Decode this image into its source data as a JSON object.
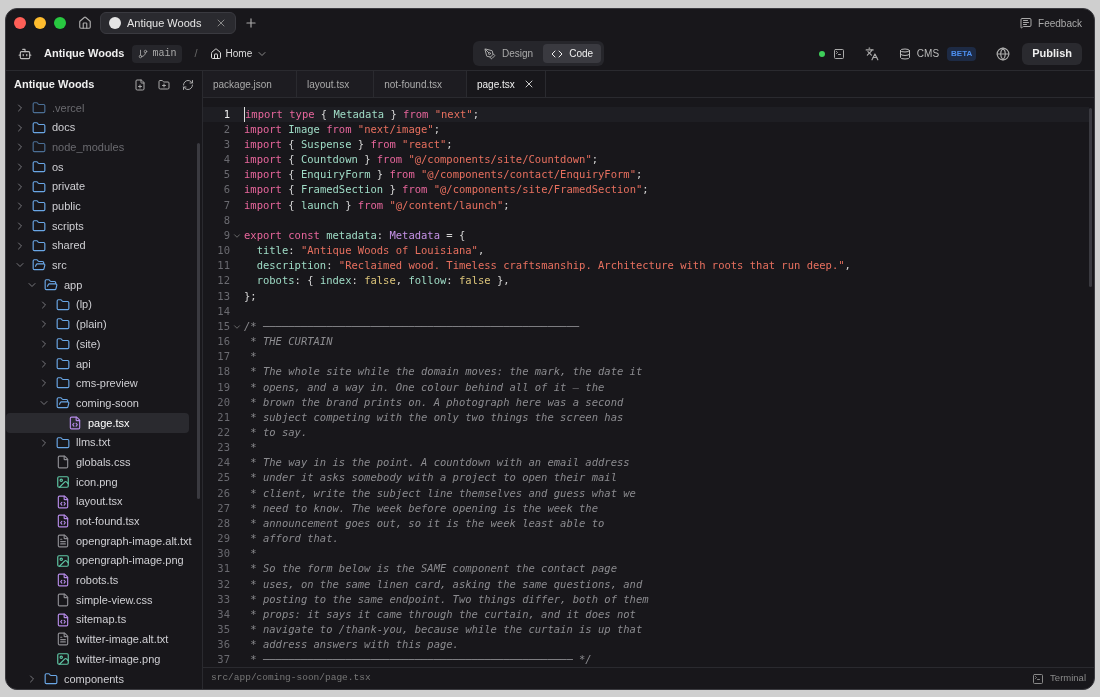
{
  "browser_tabs": [
    {
      "label": "Antique Woods",
      "selected": true
    }
  ],
  "feedback": "Feedback",
  "toolbar": {
    "project": "Antique Woods",
    "branch": "main",
    "separator": "/",
    "page": "Home",
    "modes": [
      {
        "label": "Design",
        "kind": "design",
        "selected": false
      },
      {
        "label": "Code",
        "kind": "code",
        "selected": true
      }
    ],
    "cms": "CMS",
    "cms_badge": "BETA",
    "publish": "Publish"
  },
  "sidebar": {
    "title": "Antique Woods",
    "tree": [
      {
        "name": ".vercel",
        "kind": "folder",
        "expanded": false,
        "dimmed": true
      },
      {
        "name": "docs",
        "kind": "folder",
        "expanded": false,
        "dimmed": false
      },
      {
        "name": "node_modules",
        "kind": "folder",
        "expanded": false,
        "dimmed": true
      },
      {
        "name": "os",
        "kind": "folder",
        "expanded": false,
        "dimmed": false
      },
      {
        "name": "private",
        "kind": "folder",
        "expanded": false,
        "dimmed": false
      },
      {
        "name": "public",
        "kind": "folder",
        "expanded": false,
        "dimmed": false
      },
      {
        "name": "scripts",
        "kind": "folder",
        "expanded": false,
        "dimmed": false
      },
      {
        "name": "shared",
        "kind": "folder",
        "expanded": false,
        "dimmed": false
      },
      {
        "name": "src",
        "kind": "folder",
        "expanded": true,
        "dimmed": false,
        "children": [
          {
            "name": "app",
            "kind": "folder",
            "expanded": true,
            "dimmed": false,
            "children": [
              {
                "name": "(lp)",
                "kind": "folder",
                "expanded": false,
                "dimmed": false
              },
              {
                "name": "(plain)",
                "kind": "folder",
                "expanded": false,
                "dimmed": false
              },
              {
                "name": "(site)",
                "kind": "folder",
                "expanded": false,
                "dimmed": false
              },
              {
                "name": "api",
                "kind": "folder",
                "expanded": false,
                "dimmed": false
              },
              {
                "name": "cms-preview",
                "kind": "folder",
                "expanded": false,
                "dimmed": false
              },
              {
                "name": "coming-soon",
                "kind": "folder",
                "expanded": true,
                "dimmed": false,
                "children": [
                  {
                    "name": "page.tsx",
                    "kind": "code",
                    "selected": true
                  }
                ]
              },
              {
                "name": "llms.txt",
                "kind": "folder",
                "expanded": false,
                "dimmed": false
              },
              {
                "name": "globals.css",
                "kind": "file",
                "selected": false
              },
              {
                "name": "icon.png",
                "kind": "image",
                "selected": false
              },
              {
                "name": "layout.tsx",
                "kind": "code",
                "selected": false
              },
              {
                "name": "not-found.tsx",
                "kind": "code",
                "selected": false
              },
              {
                "name": "opengraph-image.alt.txt",
                "kind": "text",
                "selected": false
              },
              {
                "name": "opengraph-image.png",
                "kind": "image",
                "selected": false
              },
              {
                "name": "robots.ts",
                "kind": "code",
                "selected": false
              },
              {
                "name": "simple-view.css",
                "kind": "file",
                "selected": false
              },
              {
                "name": "sitemap.ts",
                "kind": "code",
                "selected": false
              },
              {
                "name": "twitter-image.alt.txt",
                "kind": "text",
                "selected": false
              },
              {
                "name": "twitter-image.png",
                "kind": "image",
                "selected": false
              }
            ]
          },
          {
            "name": "components",
            "kind": "folder",
            "expanded": false,
            "dimmed": false
          }
        ]
      }
    ]
  },
  "editor_tabs": [
    {
      "label": "package.json",
      "selected": false
    },
    {
      "label": "layout.tsx",
      "selected": false
    },
    {
      "label": "not-found.tsx",
      "selected": false
    },
    {
      "label": "page.tsx",
      "selected": true
    }
  ],
  "code": [
    {
      "n": "1",
      "active": true,
      "fold": false,
      "tokens": [
        {
          "text": "import type ",
          "kind": "keyword"
        },
        {
          "text": "{ ",
          "kind": "punctuation"
        },
        {
          "text": "Metadata ",
          "kind": "identifier"
        },
        {
          "text": "} ",
          "kind": "punctuation"
        },
        {
          "text": "from ",
          "kind": "keyword"
        },
        {
          "text": "\"next\"",
          "kind": "string"
        },
        {
          "text": ";",
          "kind": "punctuation"
        }
      ]
    },
    {
      "n": "2",
      "active": false,
      "fold": false,
      "tokens": [
        {
          "text": "import ",
          "kind": "keyword"
        },
        {
          "text": "Image ",
          "kind": "identifier"
        },
        {
          "text": "from ",
          "kind": "keyword"
        },
        {
          "text": "\"next/image\"",
          "kind": "string"
        },
        {
          "text": ";",
          "kind": "punctuation"
        }
      ]
    },
    {
      "n": "3",
      "active": false,
      "fold": false,
      "tokens": [
        {
          "text": "import ",
          "kind": "keyword"
        },
        {
          "text": "{ ",
          "kind": "punctuation"
        },
        {
          "text": "Suspense ",
          "kind": "identifier"
        },
        {
          "text": "} ",
          "kind": "punctuation"
        },
        {
          "text": "from ",
          "kind": "keyword"
        },
        {
          "text": "\"react\"",
          "kind": "string"
        },
        {
          "text": ";",
          "kind": "punctuation"
        }
      ]
    },
    {
      "n": "4",
      "active": false,
      "fold": false,
      "tokens": [
        {
          "text": "import ",
          "kind": "keyword"
        },
        {
          "text": "{ ",
          "kind": "punctuation"
        },
        {
          "text": "Countdown ",
          "kind": "identifier"
        },
        {
          "text": "} ",
          "kind": "punctuation"
        },
        {
          "text": "from ",
          "kind": "keyword"
        },
        {
          "text": "\"@/components/site/Countdown\"",
          "kind": "string"
        },
        {
          "text": ";",
          "kind": "punctuation"
        }
      ]
    },
    {
      "n": "5",
      "active": false,
      "fold": false,
      "tokens": [
        {
          "text": "import ",
          "kind": "keyword"
        },
        {
          "text": "{ ",
          "kind": "punctuation"
        },
        {
          "text": "EnquiryForm ",
          "kind": "identifier"
        },
        {
          "text": "} ",
          "kind": "punctuation"
        },
        {
          "text": "from ",
          "kind": "keyword"
        },
        {
          "text": "\"@/components/contact/EnquiryForm\"",
          "kind": "string"
        },
        {
          "text": ";",
          "kind": "punctuation"
        }
      ]
    },
    {
      "n": "6",
      "active": false,
      "fold": false,
      "tokens": [
        {
          "text": "import ",
          "kind": "keyword"
        },
        {
          "text": "{ ",
          "kind": "punctuation"
        },
        {
          "text": "FramedSection ",
          "kind": "identifier"
        },
        {
          "text": "} ",
          "kind": "punctuation"
        },
        {
          "text": "from ",
          "kind": "keyword"
        },
        {
          "text": "\"@/components/site/FramedSection\"",
          "kind": "string"
        },
        {
          "text": ";",
          "kind": "punctuation"
        }
      ]
    },
    {
      "n": "7",
      "active": false,
      "fold": false,
      "tokens": [
        {
          "text": "import ",
          "kind": "keyword"
        },
        {
          "text": "{ ",
          "kind": "punctuation"
        },
        {
          "text": "launch ",
          "kind": "identifier"
        },
        {
          "text": "} ",
          "kind": "punctuation"
        },
        {
          "text": "from ",
          "kind": "keyword"
        },
        {
          "text": "\"@/content/launch\"",
          "kind": "string"
        },
        {
          "text": ";",
          "kind": "punctuation"
        }
      ]
    },
    {
      "n": "8",
      "active": false,
      "fold": false
    },
    {
      "n": "9",
      "active": false,
      "fold": true,
      "tokens": [
        {
          "text": "export const ",
          "kind": "keyword"
        },
        {
          "text": "metadata",
          "kind": "identifier"
        },
        {
          "text": ": ",
          "kind": "punctuation"
        },
        {
          "text": "Metadata ",
          "kind": "type"
        },
        {
          "text": "= {",
          "kind": "punctuation"
        }
      ]
    },
    {
      "n": "10",
      "active": false,
      "fold": false,
      "tokens": [
        {
          "text": "  title",
          "kind": "identifier"
        },
        {
          "text": ": ",
          "kind": "punctuation"
        },
        {
          "text": "\"Antique Woods of Louisiana\"",
          "kind": "string"
        },
        {
          "text": ",",
          "kind": "punctuation"
        }
      ]
    },
    {
      "n": "11",
      "active": false,
      "fold": false,
      "tokens": [
        {
          "text": "  description",
          "kind": "identifier"
        },
        {
          "text": ": ",
          "kind": "punctuation"
        },
        {
          "text": "\"Reclaimed wood. Timeless craftsmanship. Architecture with roots that run deep.\"",
          "kind": "string"
        },
        {
          "text": ",",
          "kind": "punctuation"
        }
      ]
    },
    {
      "n": "12",
      "active": false,
      "fold": false,
      "tokens": [
        {
          "text": "  robots",
          "kind": "identifier"
        },
        {
          "text": ": { ",
          "kind": "punctuation"
        },
        {
          "text": "index",
          "kind": "identifier"
        },
        {
          "text": ": ",
          "kind": "punctuation"
        },
        {
          "text": "false",
          "kind": "boolean"
        },
        {
          "text": ", ",
          "kind": "punctuation"
        },
        {
          "text": "follow",
          "kind": "identifier"
        },
        {
          "text": ": ",
          "kind": "punctuation"
        },
        {
          "text": "false ",
          "kind": "boolean"
        },
        {
          "text": "},",
          "kind": "punctuation"
        }
      ]
    },
    {
      "n": "13",
      "active": false,
      "fold": false,
      "tokens": [
        {
          "text": "};",
          "kind": "punctuation"
        }
      ]
    },
    {
      "n": "14",
      "active": false,
      "fold": false
    },
    {
      "n": "15",
      "active": false,
      "fold": true,
      "tokens": [
        {
          "text": "/* ──────────────────────────────────────────────────",
          "kind": "comment"
        }
      ]
    },
    {
      "n": "16",
      "active": false,
      "fold": false,
      "tokens": [
        {
          "text": " * THE CURTAIN",
          "kind": "comment"
        }
      ]
    },
    {
      "n": "17",
      "active": false,
      "fold": false,
      "tokens": [
        {
          "text": " *",
          "kind": "comment"
        }
      ]
    },
    {
      "n": "18",
      "active": false,
      "fold": false,
      "tokens": [
        {
          "text": " * The whole site while the domain moves: the mark, the date it",
          "kind": "comment"
        }
      ]
    },
    {
      "n": "19",
      "active": false,
      "fold": false,
      "tokens": [
        {
          "text": " * opens, and a way in. One colour behind all of it — the",
          "kind": "comment"
        }
      ]
    },
    {
      "n": "20",
      "active": false,
      "fold": false,
      "tokens": [
        {
          "text": " * brown the brand prints on. A photograph here was a second",
          "kind": "comment"
        }
      ]
    },
    {
      "n": "21",
      "active": false,
      "fold": false,
      "tokens": [
        {
          "text": " * subject competing with the only two things the screen has",
          "kind": "comment"
        }
      ]
    },
    {
      "n": "22",
      "active": false,
      "fold": false,
      "tokens": [
        {
          "text": " * to say.",
          "kind": "comment"
        }
      ]
    },
    {
      "n": "23",
      "active": false,
      "fold": false,
      "tokens": [
        {
          "text": " *",
          "kind": "comment"
        }
      ]
    },
    {
      "n": "24",
      "active": false,
      "fold": false,
      "tokens": [
        {
          "text": " * The way in is the point. A countdown with an email address",
          "kind": "comment"
        }
      ]
    },
    {
      "n": "25",
      "active": false,
      "fold": false,
      "tokens": [
        {
          "text": " * under it asks somebody with a project to open their mail",
          "kind": "comment"
        }
      ]
    },
    {
      "n": "26",
      "active": false,
      "fold": false,
      "tokens": [
        {
          "text": " * client, write the subject line themselves and guess what we",
          "kind": "comment"
        }
      ]
    },
    {
      "n": "27",
      "active": false,
      "fold": false,
      "tokens": [
        {
          "text": " * need to know. The week before opening is the week the",
          "kind": "comment"
        }
      ]
    },
    {
      "n": "28",
      "active": false,
      "fold": false,
      "tokens": [
        {
          "text": " * announcement goes out, so it is the week least able to",
          "kind": "comment"
        }
      ]
    },
    {
      "n": "29",
      "active": false,
      "fold": false,
      "tokens": [
        {
          "text": " * afford that.",
          "kind": "comment"
        }
      ]
    },
    {
      "n": "30",
      "active": false,
      "fold": false,
      "tokens": [
        {
          "text": " *",
          "kind": "comment"
        }
      ]
    },
    {
      "n": "31",
      "active": false,
      "fold": false,
      "tokens": [
        {
          "text": " * So the form below is the SAME component the contact page",
          "kind": "comment"
        }
      ]
    },
    {
      "n": "32",
      "active": false,
      "fold": false,
      "tokens": [
        {
          "text": " * uses, on the same linen card, asking the same questions, and",
          "kind": "comment"
        }
      ]
    },
    {
      "n": "33",
      "active": false,
      "fold": false,
      "tokens": [
        {
          "text": " * posting to the same endpoint. Two things differ, both of them",
          "kind": "comment"
        }
      ]
    },
    {
      "n": "34",
      "active": false,
      "fold": false,
      "tokens": [
        {
          "text": " * props: it says it came through the curtain, and it does not",
          "kind": "comment"
        }
      ]
    },
    {
      "n": "35",
      "active": false,
      "fold": false,
      "tokens": [
        {
          "text": " * navigate to /thank-you, because while the curtain is up that",
          "kind": "comment"
        }
      ]
    },
    {
      "n": "36",
      "active": false,
      "fold": false,
      "tokens": [
        {
          "text": " * address answers with this page.",
          "kind": "comment"
        }
      ]
    },
    {
      "n": "37",
      "active": false,
      "fold": false,
      "tokens": [
        {
          "text": " * ───────────────────────────────────────────────── */",
          "kind": "comment"
        }
      ]
    }
  ],
  "status_bar": {
    "path": "src/app/coming-soon/page.tsx",
    "terminal": "Terminal"
  }
}
